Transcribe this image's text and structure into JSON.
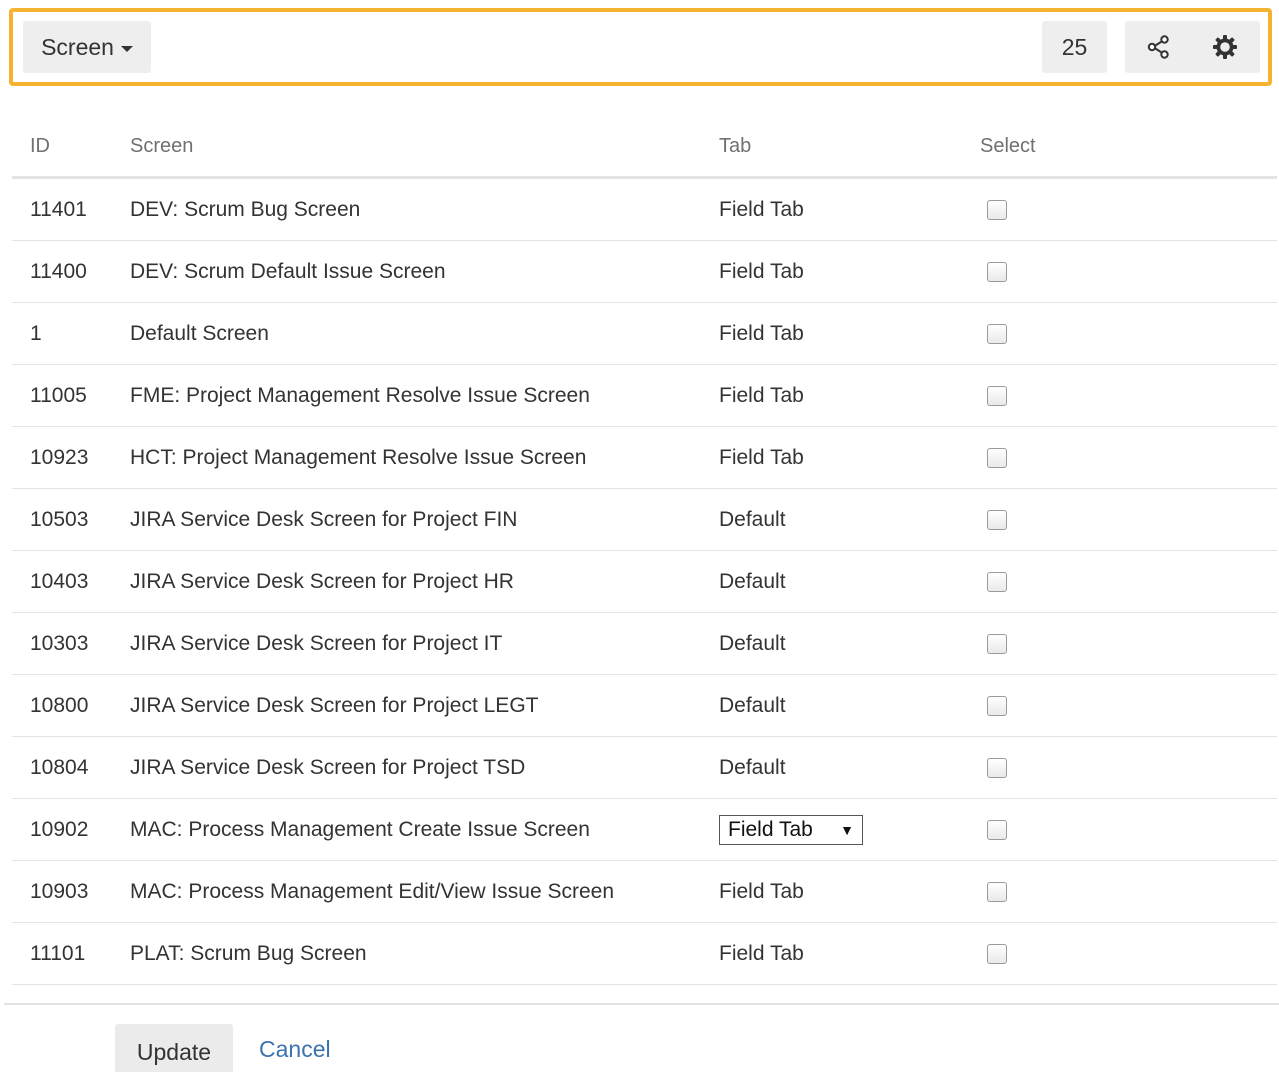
{
  "toolbar": {
    "screen_dropdown_label": "Screen",
    "count": "25",
    "share_icon": "share-icon",
    "settings_icon": "gear-icon",
    "highlight_color": "#f6b332"
  },
  "table": {
    "headers": {
      "id": "ID",
      "screen": "Screen",
      "tab": "Tab",
      "select": "Select"
    },
    "rows": [
      {
        "id": "11401",
        "screen": "DEV: Scrum Bug Screen",
        "tab": "Field Tab"
      },
      {
        "id": "11400",
        "screen": "DEV: Scrum Default Issue Screen",
        "tab": "Field Tab"
      },
      {
        "id": "1",
        "screen": "Default Screen",
        "tab": "Field Tab"
      },
      {
        "id": "11005",
        "screen": "FME: Project Management Resolve Issue Screen",
        "tab": "Field Tab"
      },
      {
        "id": "10923",
        "screen": "HCT: Project Management Resolve Issue Screen",
        "tab": "Field Tab"
      },
      {
        "id": "10503",
        "screen": "JIRA Service Desk Screen for Project FIN",
        "tab": "Default"
      },
      {
        "id": "10403",
        "screen": "JIRA Service Desk Screen for Project HR",
        "tab": "Default"
      },
      {
        "id": "10303",
        "screen": "JIRA Service Desk Screen for Project IT",
        "tab": "Default"
      },
      {
        "id": "10800",
        "screen": "JIRA Service Desk Screen for Project LEGT",
        "tab": "Default"
      },
      {
        "id": "10804",
        "screen": "JIRA Service Desk Screen for Project TSD",
        "tab": "Default"
      },
      {
        "id": "10902",
        "screen": "MAC: Process Management Create Issue Screen",
        "tab": "Field Tab",
        "tab_is_select": true
      },
      {
        "id": "10903",
        "screen": "MAC: Process Management Edit/View Issue Screen",
        "tab": "Field Tab"
      },
      {
        "id": "11101",
        "screen": "PLAT: Scrum Bug Screen",
        "tab": "Field Tab"
      }
    ]
  },
  "footer": {
    "update_label": "Update",
    "cancel_label": "Cancel",
    "link_color": "#3b73af"
  }
}
